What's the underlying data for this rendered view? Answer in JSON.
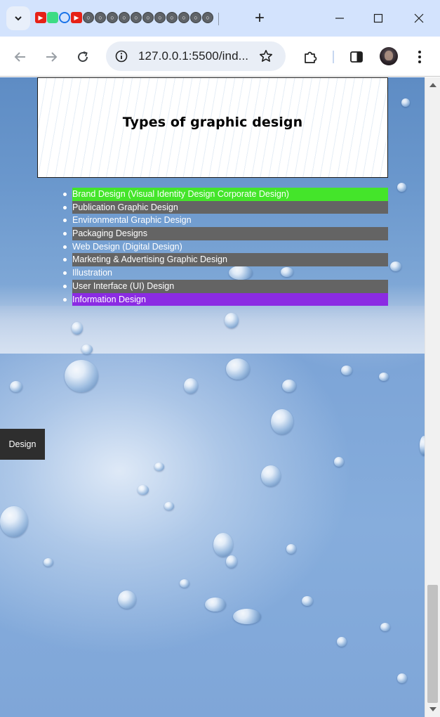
{
  "browser": {
    "tabs": [
      {
        "icon": "youtube-icon"
      },
      {
        "icon": "android-icon"
      },
      {
        "icon": "history-icon"
      },
      {
        "icon": "youtube-icon"
      },
      {
        "icon": "globe-icon"
      },
      {
        "icon": "globe-icon"
      },
      {
        "icon": "globe-icon"
      },
      {
        "icon": "globe-icon"
      },
      {
        "icon": "globe-icon"
      },
      {
        "icon": "globe-icon"
      },
      {
        "icon": "globe-icon"
      },
      {
        "icon": "globe-icon"
      },
      {
        "icon": "globe-icon"
      },
      {
        "icon": "globe-icon"
      },
      {
        "icon": "globe-icon"
      }
    ],
    "new_tab_label": "+",
    "url": "127.0.0.1:5500/ind..."
  },
  "page": {
    "banner_title": "Types of graphic design",
    "design_types": [
      {
        "label": "Brand Design (Visual Identity Design Corporate Design)",
        "style": "green"
      },
      {
        "label": "Publication Graphic Design",
        "style": "dark"
      },
      {
        "label": "Environmental Graphic Design",
        "style": "plain"
      },
      {
        "label": "Packaging Designs",
        "style": "dark"
      },
      {
        "label": "Web Design (Digital Design)",
        "style": "plain"
      },
      {
        "label": "Marketing & Advertising Graphic Design",
        "style": "dark"
      },
      {
        "label": "Illustration",
        "style": "plain"
      },
      {
        "label": "User Interface (UI) Design",
        "style": "dark"
      },
      {
        "label": "Information Design",
        "style": "purple"
      }
    ],
    "side_button_label": "Design"
  },
  "colors": {
    "highlight_green": "#44e52a",
    "highlight_purple": "#8b2be3",
    "row_dark": "#646464",
    "button_dark": "#2e2e2e",
    "titlebar": "#d3e3fd"
  }
}
